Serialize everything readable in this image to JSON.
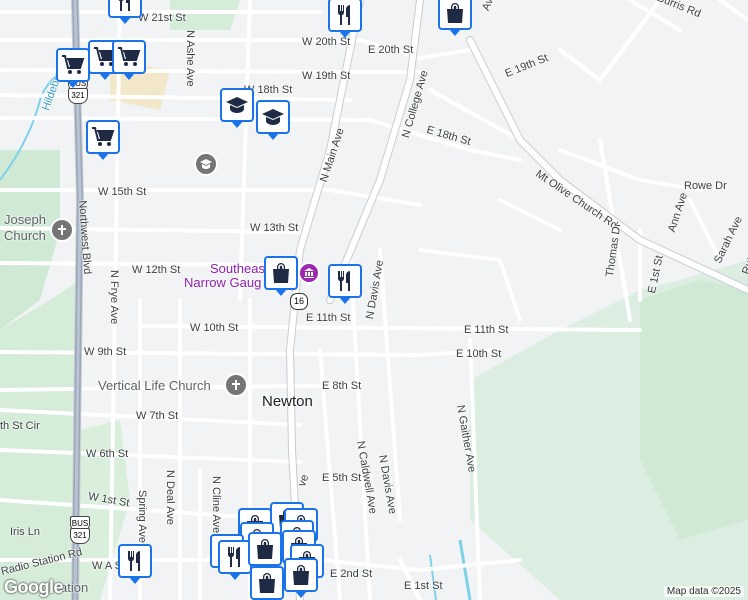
{
  "map": {
    "city_label": "Newton",
    "attribution": "Map data ©2025",
    "logo": "Google",
    "colors": {
      "road": "#ffffff",
      "road_edge": "#c8cdd3",
      "park": "#cfe9d4",
      "water": "#7fd1ea",
      "marker_border": "#1a73e8",
      "background": "#f1f3f4"
    },
    "streets": {
      "w21": "W 21st St",
      "w20": "W 20th St",
      "e20": "E 20th St",
      "w19": "W 19th St",
      "e19": "E 19th St",
      "w18": "W 18th St",
      "e18": "E 18th St",
      "w15": "W 15th St",
      "w13": "W 13th St",
      "w12": "W 12th St",
      "w10": "W 10th St",
      "e11": "E 11th St",
      "e11b": "E 11th St",
      "w9": "W 9th St",
      "e10": "E 10th St",
      "e8": "E 8th St",
      "w7": "W 7th St",
      "w6": "W 6th St",
      "e5": "E 5th St",
      "w1": "W 1st St",
      "e2": "E 2nd St",
      "e1": "E 1st St",
      "nashe": "N Ashe Ave",
      "nmain": "N Main Ave",
      "ncollege": "N College Ave",
      "ndavis": "N Davis Ave",
      "ndavis2": "N Davis Ave",
      "ncaldwell": "N Caldwell Ave",
      "ngaither": "N Gaither Ave",
      "nfrye": "N Frye Ave",
      "ndeal": "N Deal Ave",
      "ncline": "N Cline Ave",
      "spring": "Spring Ave",
      "northwest": "Northwest Blvd",
      "mtolive": "Mt Olive Church Rd",
      "rowe": "Rowe Dr",
      "ann": "Ann Ave",
      "sarah": "Sarah Ave",
      "thomas": "Thomas Dr",
      "e1st": "E 1st St",
      "burris": "Burris Rd",
      "iris": "Iris Ln",
      "radio": "Radio Station Rd",
      "hildebran": "Hildebran",
      "th_cir": "th St Cir",
      "was": "W A S",
      "ave_frag": "Ave",
      "nmain_lower": "ve",
      "station": "ation",
      "rut": "Rut"
    },
    "pois": {
      "joseph_church": "Joseph",
      "joseph_church2": "Church",
      "southeast": "Southeas",
      "narrow": "Narrow Gaug",
      "vertical": "Vertical Life Church"
    },
    "shields": {
      "us321_top": "321",
      "us321_bot": "321",
      "bus": "BUS",
      "nc16": "16"
    },
    "icons": [
      "shopping-bag-icon",
      "restaurant-icon",
      "shopping-cart-icon",
      "school-icon",
      "church-icon",
      "museum-icon"
    ]
  }
}
